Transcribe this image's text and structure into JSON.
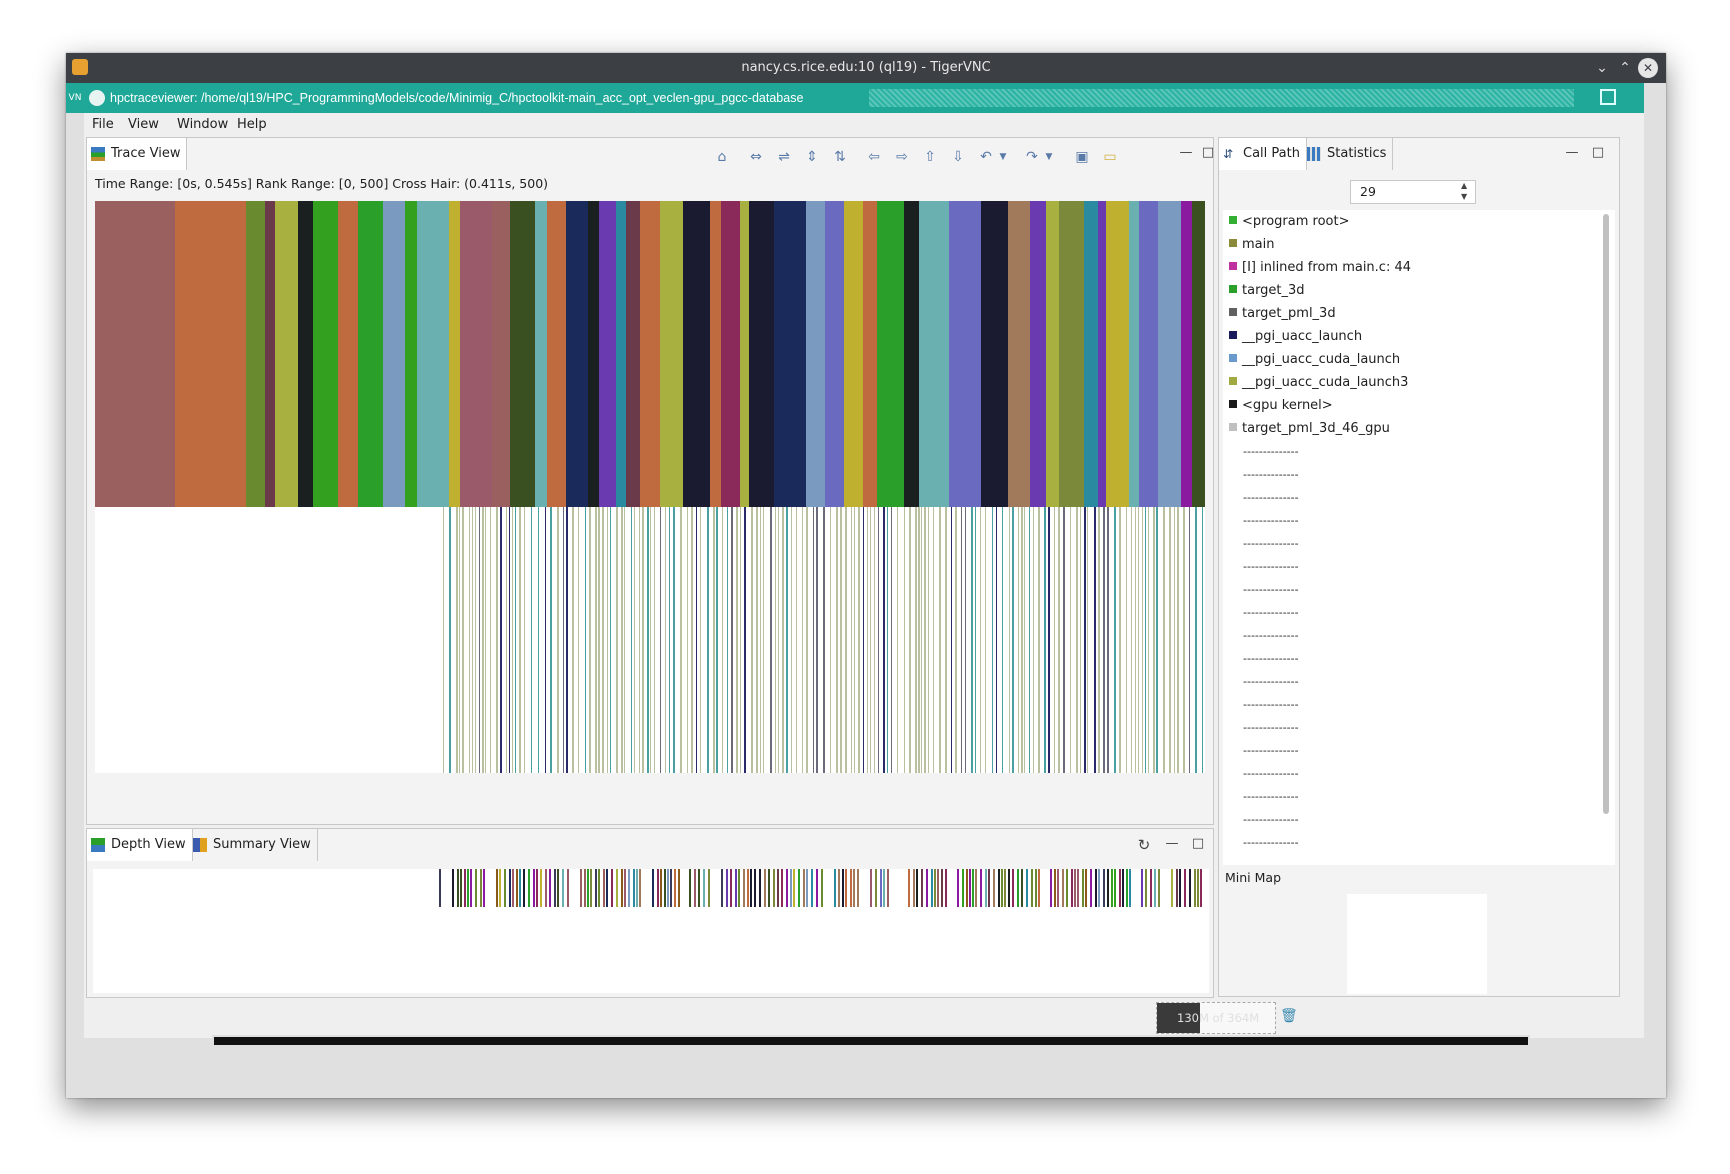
{
  "vnc": {
    "title": "nancy.cs.rice.edu:10 (ql19) - TigerVNC",
    "side_label": "VN"
  },
  "app": {
    "title": "hpctraceviewer: /home/ql19/HPC_ProgrammingModels/code/Minimig_C/hpctoolkit-main_acc_opt_veclen-gpu_pgcc-database"
  },
  "menu": [
    "File",
    "View",
    "Window",
    "Help"
  ],
  "trace_view": {
    "tab_label": "Trace View",
    "info": "Time Range: [0s, 0.545s]  Rank Range: [0, 500]  Cross Hair: (0.411s, 500)",
    "toolbar_icons": [
      "home-icon",
      "expand-horizontal-icon",
      "shrink-horizontal-icon",
      "expand-vertical-icon",
      "shrink-vertical-icon",
      "arrow-left-icon",
      "arrow-right-icon",
      "arrow-up-icon",
      "arrow-down-icon",
      "undo-icon",
      "redo-icon",
      "save-icon",
      "open-folder-icon"
    ]
  },
  "depth_view": {
    "tabs": [
      "Depth View",
      "Summary View"
    ]
  },
  "call_path": {
    "tabs": [
      "Call Path",
      "Statistics"
    ],
    "depth_value": "29",
    "items": [
      {
        "label": "<program root>",
        "color": "#33b033"
      },
      {
        "label": "main",
        "color": "#8a8a3a"
      },
      {
        "label": "[I] inlined from main.c: 44",
        "color": "#c030a0"
      },
      {
        "label": "target_3d",
        "color": "#2aa02a"
      },
      {
        "label": "target_pml_3d",
        "color": "#606060"
      },
      {
        "label": "__pgi_uacc_launch",
        "color": "#1a1a5a"
      },
      {
        "label": "__pgi_uacc_cuda_launch",
        "color": "#6a9acc"
      },
      {
        "label": "__pgi_uacc_cuda_launch3",
        "color": "#a0aa40"
      },
      {
        "label": "<gpu kernel>",
        "color": "#1a1a1a"
      },
      {
        "label": "target_pml_3d_46_gpu",
        "color": "#c0c0c0"
      }
    ],
    "placeholder": "--------------",
    "mini_map_label": "Mini Map"
  },
  "status": {
    "memory": "130M of 364M"
  },
  "colors": {
    "titlebar": "#3c3f44",
    "app_title": "#1fa898"
  }
}
